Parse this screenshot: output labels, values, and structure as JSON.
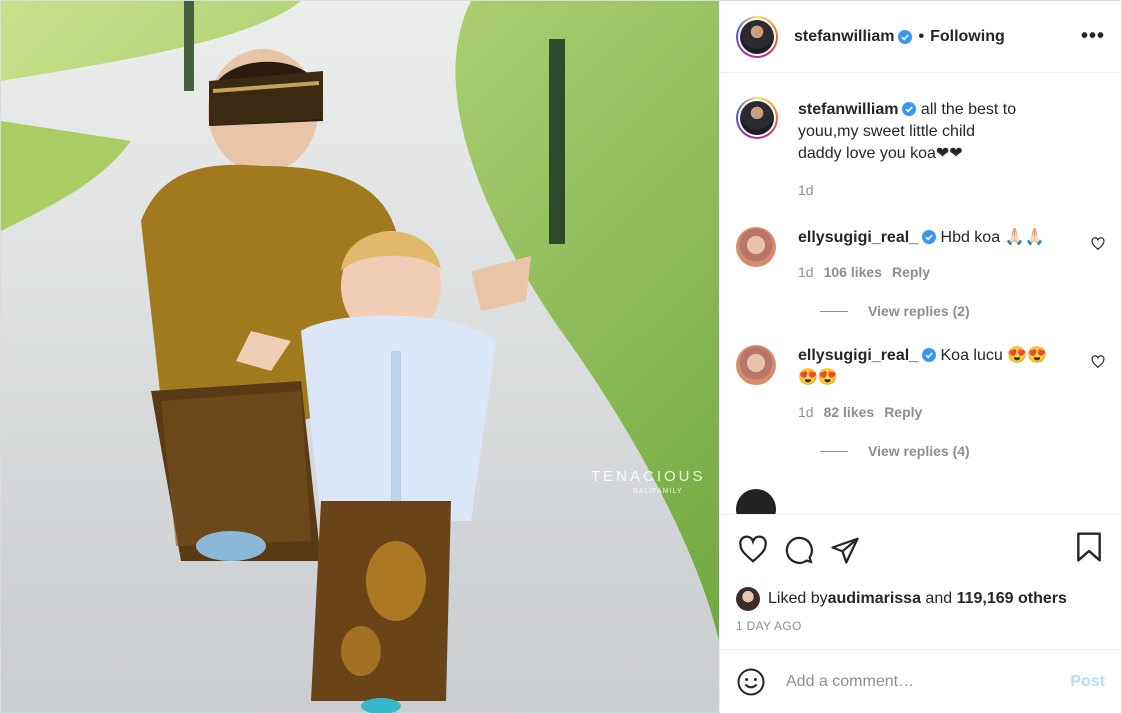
{
  "photo": {
    "watermark_main": "TENACIOUS",
    "watermark_sub": "BALIFAMILY"
  },
  "header": {
    "username": "stefanwilliam",
    "separator": "•",
    "follow_state": "Following",
    "more": "•••"
  },
  "caption": {
    "username": "stefanwilliam",
    "text_line1": " all the best to",
    "text_line2": "youu,my sweet little child",
    "text_line3": "daddy love you koa❤❤",
    "age": "1d"
  },
  "comments": [
    {
      "username": "ellysugigi_real_",
      "text": " Hbd koa 🙏🏻🙏🏻",
      "age": "1d",
      "likes": "106 likes",
      "reply": "Reply",
      "view_replies": "View replies (2)"
    },
    {
      "username": "ellysugigi_real_",
      "text": " Koa lucu 😍😍",
      "text_line2": "😍😍",
      "age": "1d",
      "likes": "82 likes",
      "reply": "Reply",
      "view_replies": "View replies (4)"
    }
  ],
  "likes": {
    "prefix": "Liked by ",
    "liker": "audimarissa",
    "and": " and ",
    "others": "119,169 others"
  },
  "timestamp": "1 DAY AGO",
  "add_comment": {
    "placeholder": "Add a comment…",
    "post_label": "Post"
  },
  "colors": {
    "verified": "#3897f0",
    "post_disabled": "#b2dffc",
    "muted": "#8e8e8e"
  }
}
